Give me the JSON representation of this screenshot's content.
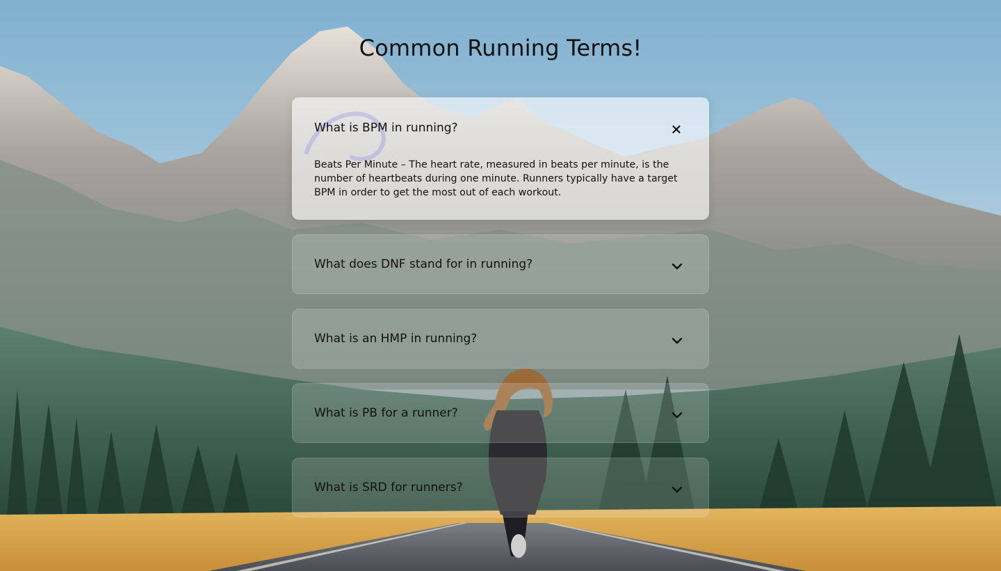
{
  "page": {
    "title": "Common Running Terms!"
  },
  "faqs": [
    {
      "question": "What is BPM in running?",
      "answer": "Beats Per Minute – The heart rate, measured in beats per minute, is the number of heartbeats during one minute. Runners typically have a target BPM in order to get the most out of each workout.",
      "expanded": true,
      "icon": "close-icon"
    },
    {
      "question": "What does DNF stand for in running?",
      "expanded": false,
      "icon": "chevron-down-icon"
    },
    {
      "question": "What is an HMP in running?",
      "expanded": false,
      "icon": "chevron-down-icon"
    },
    {
      "question": "What is PB for a runner?",
      "expanded": false,
      "icon": "chevron-down-icon"
    },
    {
      "question": "What is SRD for runners?",
      "expanded": false,
      "icon": "chevron-down-icon"
    }
  ],
  "colors": {
    "sky": "#8fb6d2",
    "mountain": "#8a8f8d",
    "forest": "#2f5a45",
    "field": "#d8a34a",
    "road": "#5a5f66",
    "text": "#111111"
  }
}
